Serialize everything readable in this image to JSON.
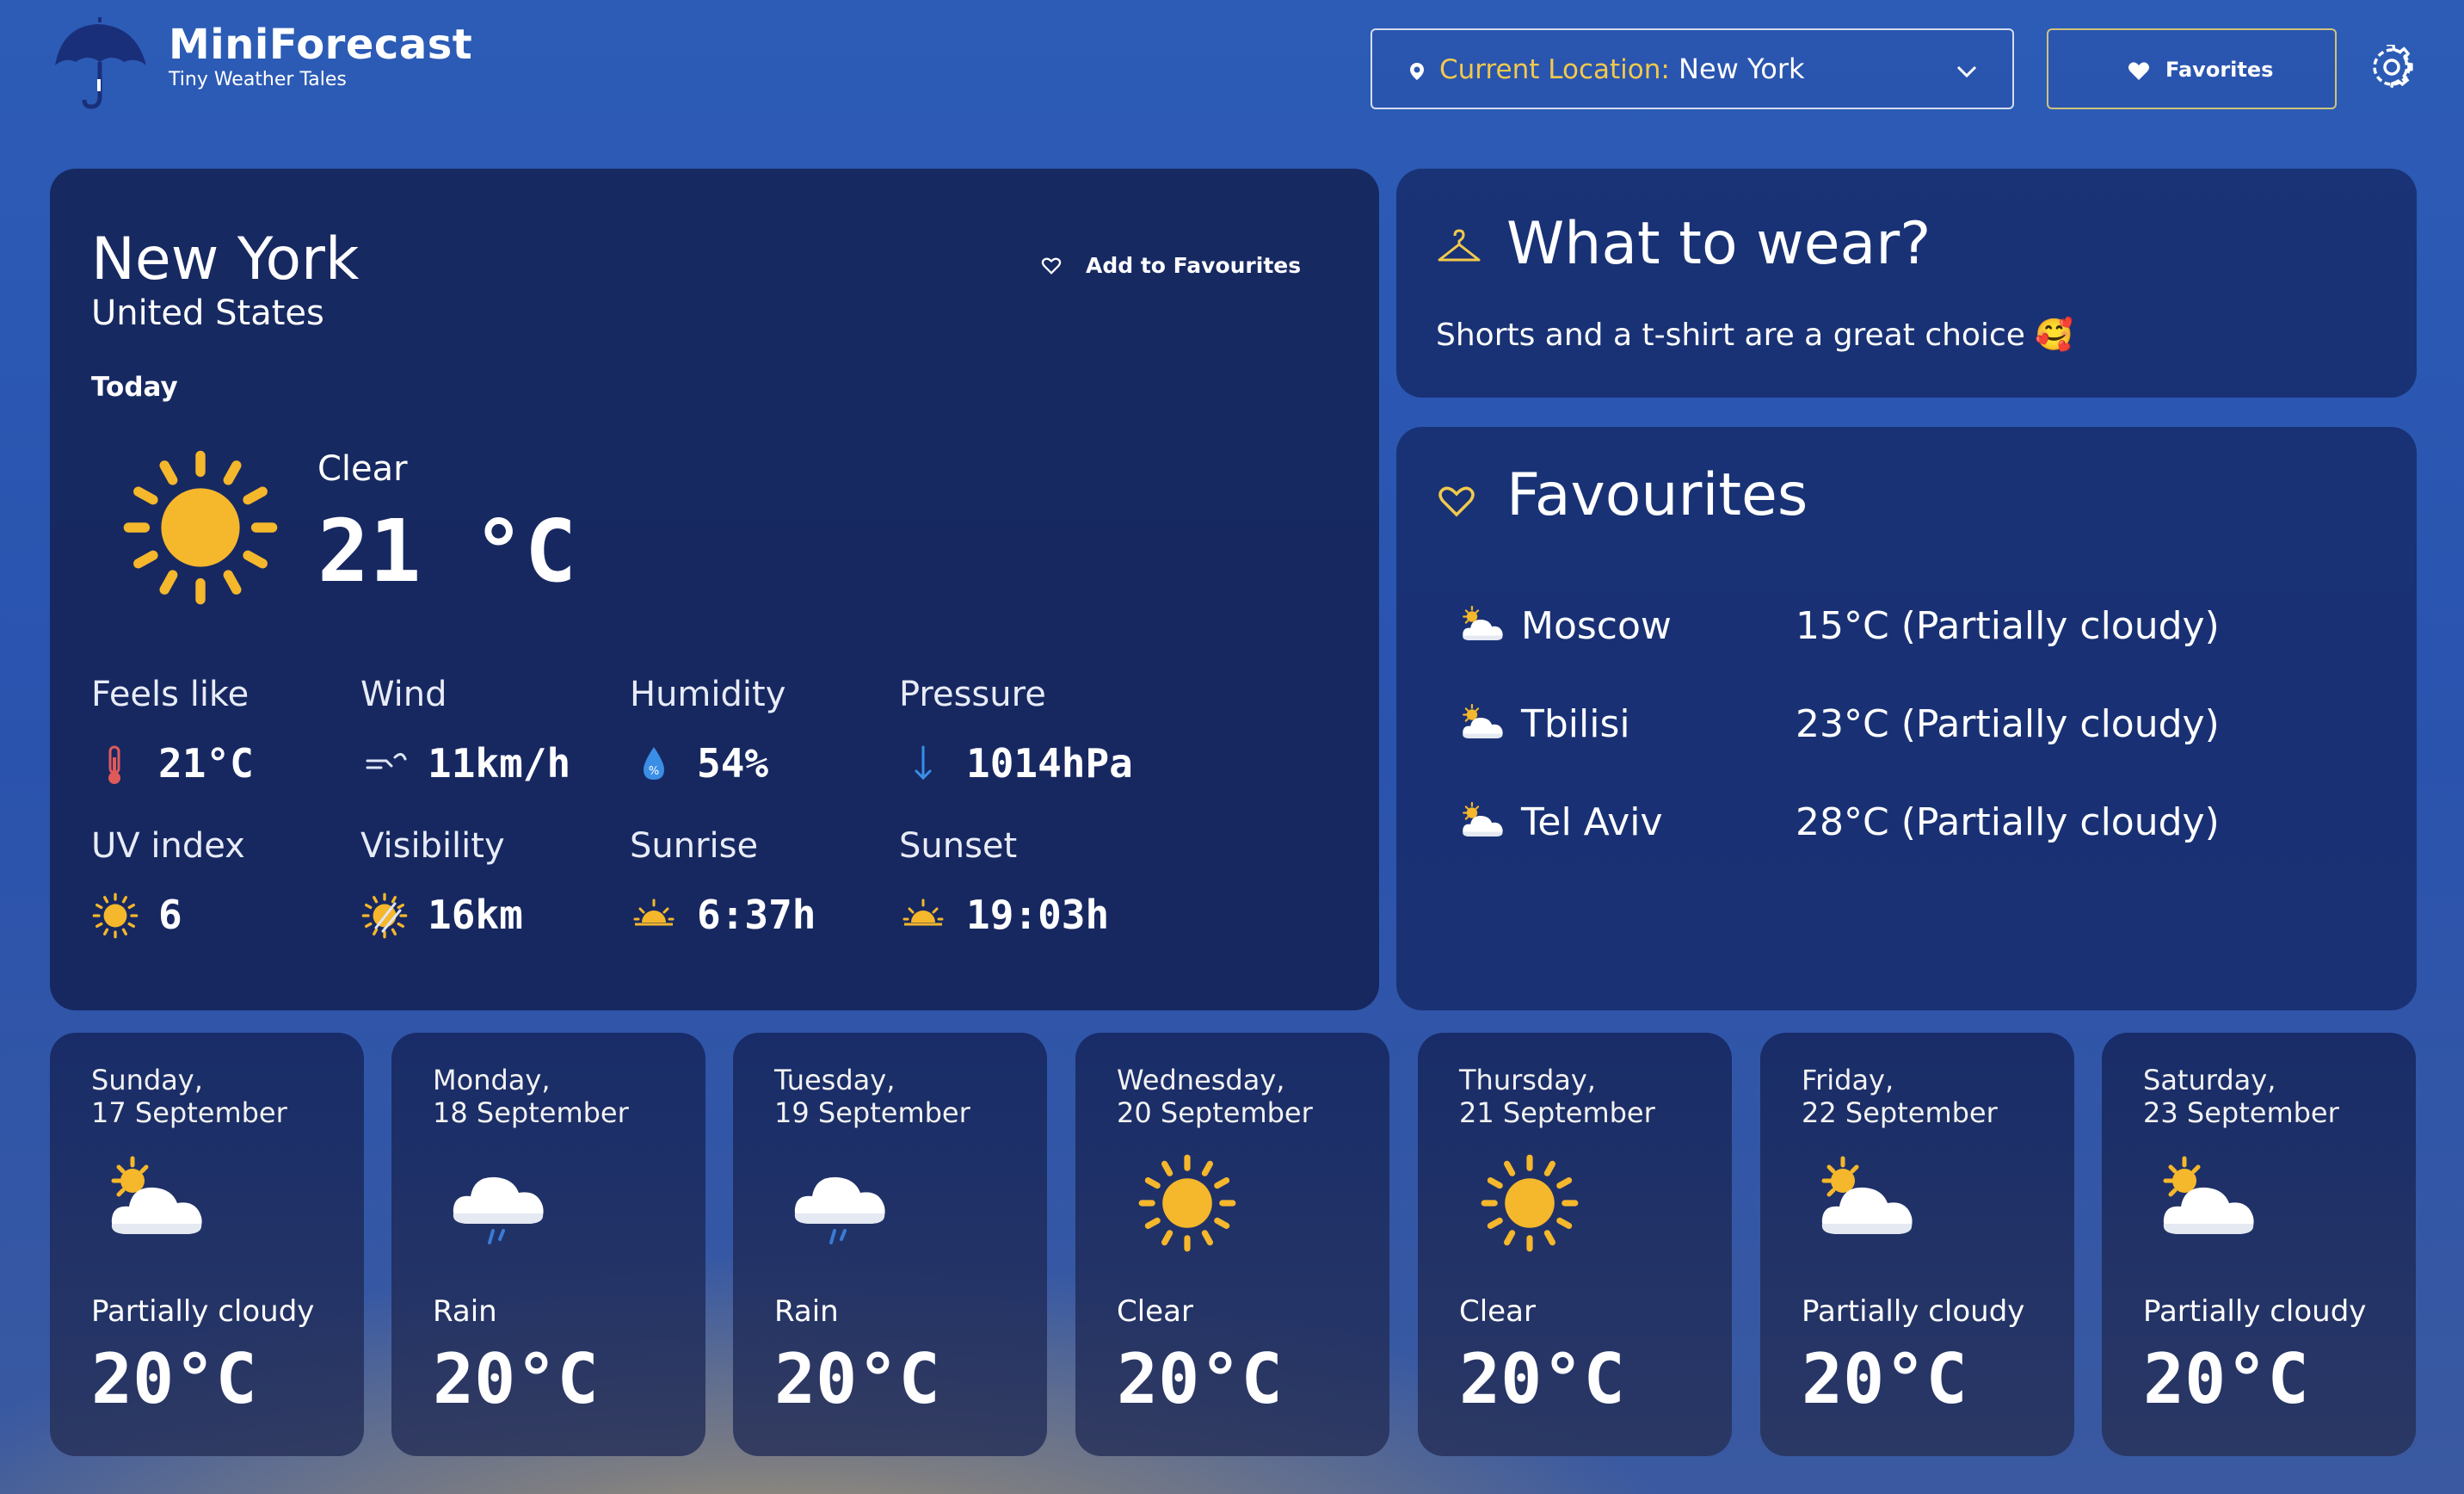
{
  "app": {
    "title": "MiniForecast",
    "subtitle": "Tiny Weather Tales"
  },
  "header": {
    "location_label": "Current Location:",
    "location_value": "New York",
    "favorites_label": "Favorites",
    "icons": [
      "umbrella-logo",
      "location-pin-icon",
      "chevron-down-icon",
      "heart-icon",
      "gear-icon"
    ]
  },
  "current": {
    "city": "New York",
    "country": "United States",
    "add_favourites": "Add to Favourites",
    "day_label": "Today",
    "condition": "Clear",
    "temperature": "21 °C",
    "metrics": [
      {
        "label": "Feels like",
        "value": "21°C",
        "icon": "thermometer-icon"
      },
      {
        "label": "Wind",
        "value": "11km/h",
        "icon": "wind-icon"
      },
      {
        "label": "Humidity",
        "value": "54%",
        "icon": "humidity-drop-icon"
      },
      {
        "label": "Pressure",
        "value": "1014hPa",
        "icon": "arrow-down-icon"
      },
      {
        "label": "UV index",
        "value": "6",
        "icon": "uv-sun-icon"
      },
      {
        "label": "Visibility",
        "value": "16km",
        "icon": "visibility-icon"
      },
      {
        "label": "Sunrise",
        "value": "6:37h",
        "icon": "sunrise-icon"
      },
      {
        "label": "Sunset",
        "value": "19:03h",
        "icon": "sunset-icon"
      }
    ]
  },
  "wear": {
    "title": "What to wear?",
    "text": "Shorts and a t-shirt are a great choice 🥰"
  },
  "favourites": {
    "title": "Favourites",
    "items": [
      {
        "city": "Moscow",
        "weather": "15°C (Partially cloudy)"
      },
      {
        "city": "Tbilisi",
        "weather": "23°C (Partially cloudy)"
      },
      {
        "city": "Tel Aviv",
        "weather": "28°C (Partially cloudy)"
      }
    ]
  },
  "forecast": [
    {
      "day": "Sunday,",
      "date": "17 September",
      "condition": "Partially cloudy",
      "temp": "20°C",
      "icon": "partly-cloudy-icon"
    },
    {
      "day": "Monday,",
      "date": "18 September",
      "condition": "Rain",
      "temp": "20°C",
      "icon": "rain-cloud-icon"
    },
    {
      "day": "Tuesday,",
      "date": "19 September",
      "condition": "Rain",
      "temp": "20°C",
      "icon": "rain-cloud-icon"
    },
    {
      "day": "Wednesday,",
      "date": "20 September",
      "condition": "Clear",
      "temp": "20°C",
      "icon": "sun-icon"
    },
    {
      "day": "Thursday,",
      "date": "21 September",
      "condition": "Clear",
      "temp": "20°C",
      "icon": "sun-icon"
    },
    {
      "day": "Friday,",
      "date": "22 September",
      "condition": "Partially cloudy",
      "temp": "20°C",
      "icon": "partly-cloudy-icon"
    },
    {
      "day": "Saturday,",
      "date": "23 September",
      "condition": "Partially cloudy",
      "temp": "20°C",
      "icon": "partly-cloudy-icon"
    }
  ],
  "colors": {
    "accent_yellow": "#f2c94c",
    "sun": "#f5b72b",
    "card": "#16285e"
  }
}
